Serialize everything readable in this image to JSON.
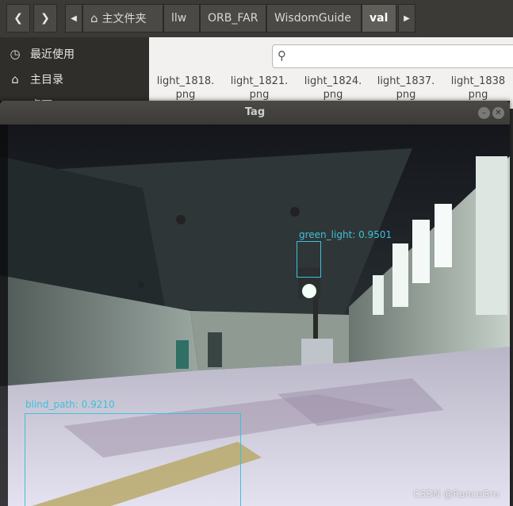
{
  "file_manager": {
    "nav": {
      "back_icon": "chevron-left-icon",
      "forward_icon": "chevron-right-icon"
    },
    "breadcrumbs": [
      {
        "label": "主文件夹",
        "icon": "home-icon"
      },
      {
        "label": "llw"
      },
      {
        "label": "ORB_FAR"
      },
      {
        "label": "WisdomGuide"
      },
      {
        "label": "val",
        "active": true
      }
    ],
    "sidebar": [
      {
        "label": "最近使用",
        "icon": "clock-icon"
      },
      {
        "label": "主目录",
        "icon": "home-icon"
      },
      {
        "label": "桌面",
        "icon": "folder-icon"
      }
    ],
    "files": [
      {
        "line1": "light_1818.",
        "line2": "png"
      },
      {
        "line1": "light_1821.",
        "line2": "png"
      },
      {
        "line1": "light_1824.",
        "line2": "png"
      },
      {
        "line1": "light_1837.",
        "line2": "png"
      },
      {
        "line1": "light_1838",
        "line2": "png"
      }
    ]
  },
  "tag_window": {
    "title": "Tag",
    "detections": [
      {
        "label": "green_light: 0.9501",
        "color": "#3fc0d8"
      },
      {
        "label": "blind_path: 0.9210",
        "color": "#3fc0d8"
      }
    ]
  },
  "watermark": "CSDN @RanceGru"
}
